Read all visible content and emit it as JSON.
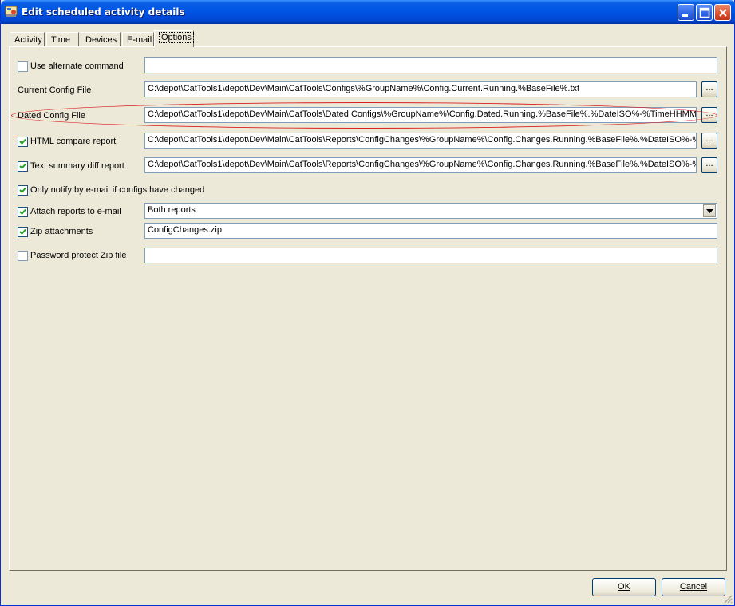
{
  "window": {
    "title": "Edit scheduled activity details",
    "controls": [
      "minimize-icon",
      "maximize-icon",
      "close-icon"
    ]
  },
  "tabs": [
    {
      "label": "Activity",
      "active": false
    },
    {
      "label": "Time",
      "active": false
    },
    {
      "label": "Devices",
      "active": false
    },
    {
      "label": "E-mail",
      "active": false
    },
    {
      "label": "Options",
      "active": true
    }
  ],
  "options": {
    "use_alternate_command": {
      "label": "Use alternate command",
      "checked": false,
      "value": ""
    },
    "current_config_file": {
      "label": "Current Config File",
      "value": "C:\\depot\\CatTools1\\depot\\Dev\\Main\\CatTools\\Configs\\%GroupName%\\Config.Current.Running.%BaseFile%.txt",
      "browse_label": "..."
    },
    "dated_config_file": {
      "label": "Dated Config File",
      "value": "C:\\depot\\CatTools1\\depot\\Dev\\Main\\CatTools\\Dated Configs\\%GroupName%\\Config.Dated.Running.%BaseFile%.%DateISO%-%TimeHHMM%.",
      "browse_label": "...",
      "highlight_color": "#d81f1f"
    },
    "html_compare_report": {
      "label": "HTML compare report",
      "checked": true,
      "value": "C:\\depot\\CatTools1\\depot\\Dev\\Main\\CatTools\\Reports\\ConfigChanges\\%GroupName%\\Config.Changes.Running.%BaseFile%.%DateISO%-%Ti",
      "browse_label": "..."
    },
    "text_summary_diff_report": {
      "label": "Text summary diff report",
      "checked": true,
      "value": "C:\\depot\\CatTools1\\depot\\Dev\\Main\\CatTools\\Reports\\ConfigChanges\\%GroupName%\\Config.Changes.Running.%BaseFile%.%DateISO%-%Ti",
      "browse_label": "..."
    },
    "only_notify": {
      "label": "Only notify by e-mail if configs have changed",
      "checked": true
    },
    "attach_reports": {
      "label": "Attach reports to e-mail",
      "checked": true,
      "selected": "Both reports"
    },
    "zip_attachments": {
      "label": "Zip attachments",
      "checked": true,
      "value": "ConfigChanges.zip"
    },
    "password_protect_zip": {
      "label": "Password protect Zip file",
      "checked": false,
      "value": ""
    }
  },
  "buttons": {
    "ok": {
      "label": "OK",
      "accel": "O"
    },
    "cancel": {
      "label": "Cancel",
      "accel": "C"
    }
  },
  "colors": {
    "titlebar": "#0055e5",
    "dialog_bg": "#ece9d8",
    "field_border": "#7f9db9",
    "checkbox_border": "#1c5180",
    "checkmark": "#21a121"
  }
}
